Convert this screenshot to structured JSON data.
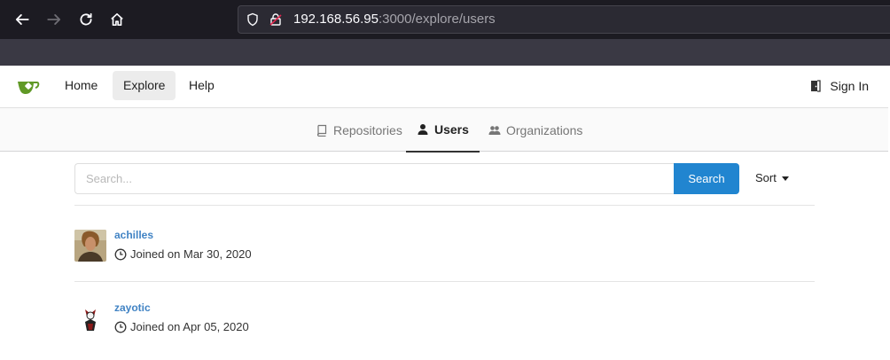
{
  "browser": {
    "url_host": "192.168.56.95",
    "url_path": ":3000/explore/users",
    "icons": [
      "back-icon",
      "forward-icon",
      "reload-icon",
      "home-icon",
      "shield-icon",
      "insecure-lock-icon"
    ]
  },
  "header": {
    "logo_icon": "gitea-logo-icon",
    "menu": [
      {
        "label": "Home"
      },
      {
        "label": "Explore",
        "active": true
      },
      {
        "label": "Help"
      }
    ],
    "signin_label": "Sign In"
  },
  "tabs": [
    {
      "label": "Repositories",
      "icon": "repo-icon"
    },
    {
      "label": "Users",
      "icon": "person-icon",
      "active": true
    },
    {
      "label": "Organizations",
      "icon": "organization-icon"
    }
  ],
  "search": {
    "placeholder": "Search...",
    "value": "",
    "button_label": "Search",
    "sort_label": "Sort"
  },
  "users": [
    {
      "name": "achilles",
      "joined": "Joined on Mar 30, 2020"
    },
    {
      "name": "zayotic",
      "joined": "Joined on Apr 05, 2020"
    }
  ],
  "colors": {
    "primary": "#2185d0",
    "link": "#4183c4",
    "browser_dark": "#1c1b22",
    "gitea_green": "#609926"
  }
}
